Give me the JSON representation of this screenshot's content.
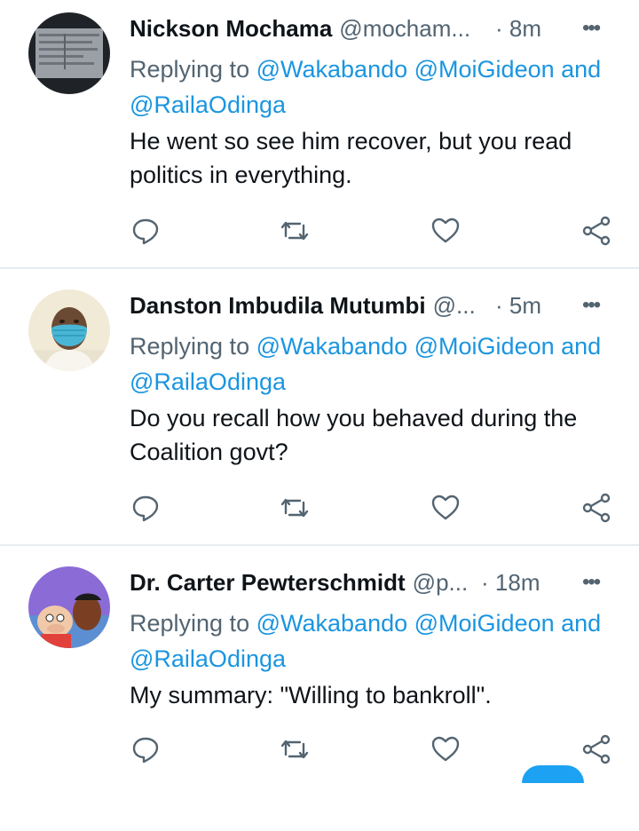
{
  "tweets": [
    {
      "name": "Nickson Mochama",
      "handle": "@mocham...",
      "separator": "·",
      "time": "8m",
      "more": "•••",
      "reply_prefix": "Replying to",
      "mention_1": "@Wakabando",
      "mention_2": "@MoiGideon",
      "reply_and": "and",
      "mention_3": "@RailaOdinga",
      "text_line1": "He went so see him recover, but you read",
      "text_line2": "politics in everything."
    },
    {
      "name": "Danston Imbudila Mutumbi",
      "handle": "@...",
      "separator": "·",
      "time": "5m",
      "more": "•••",
      "reply_prefix": "Replying to",
      "mention_1": "@Wakabando",
      "mention_2": "@MoiGideon",
      "reply_and": "and",
      "mention_3": "@RailaOdinga",
      "text_line1": "Do you recall how you behaved during the",
      "text_line2": "Coalition govt?"
    },
    {
      "name": "Dr. Carter Pewterschmidt",
      "handle": "@p...",
      "separator": "·",
      "time": "18m",
      "more": "•••",
      "reply_prefix": "Replying to",
      "mention_1": "@Wakabando",
      "mention_2": "@MoiGideon",
      "reply_and": "and",
      "mention_3": "@RailaOdinga",
      "text_line1": "My summary: \"Willing to bankroll\".",
      "text_line2": ""
    }
  ],
  "colors": {
    "link": "#1b95e0",
    "secondary": "#536471",
    "primary": "#0f1419",
    "divider": "#e6ecf0"
  },
  "icons": [
    "reply-icon",
    "retweet-icon",
    "like-icon",
    "share-icon",
    "more-icon"
  ]
}
